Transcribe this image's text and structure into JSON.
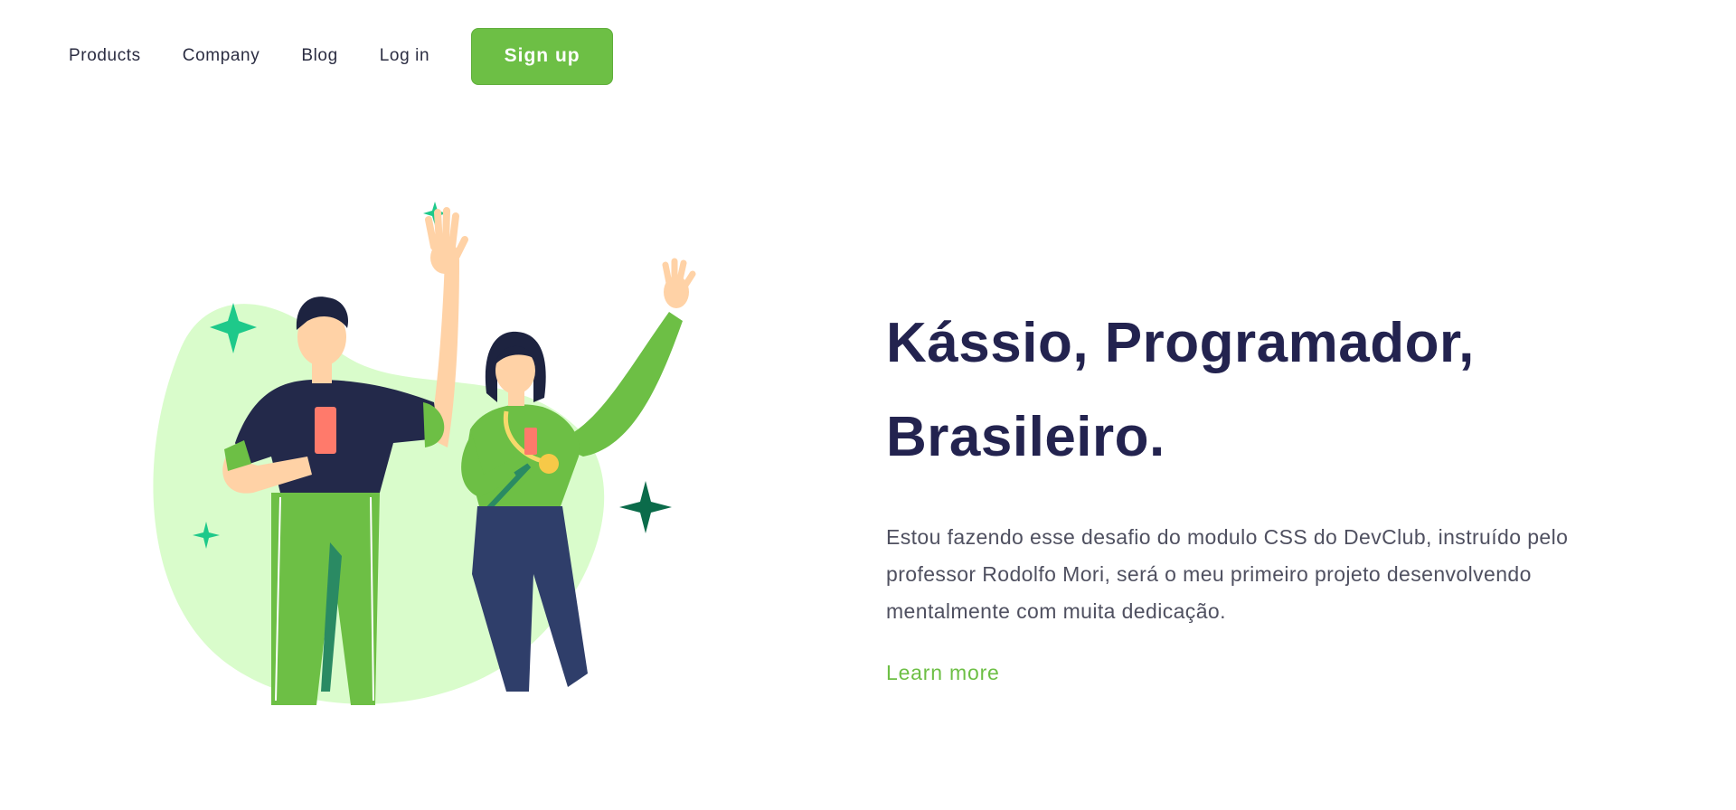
{
  "nav": {
    "links": [
      {
        "label": "Products"
      },
      {
        "label": "Company"
      },
      {
        "label": "Blog"
      },
      {
        "label": "Log in"
      }
    ],
    "signup_label": "Sign up"
  },
  "hero": {
    "title_line1": "Kássio, Programador,",
    "title_line2": "Brasileiro.",
    "description": "Estou fazendo esse desafio do modulo CSS do DevClub, instruído pelo professor Rodolfo Mori, será o meu primeiro projeto desenvolvendo mentalmente com muita dedicação.",
    "learn_more": "Learn more"
  },
  "colors": {
    "accent": "#6dbf45",
    "title": "#23234f",
    "body_text": "#4f5060",
    "blob": "#d9fccb",
    "sparkle": "#1ec98a",
    "sparkle_dark": "#0b6b4a"
  },
  "illustration": {
    "description_icon": "two-people-celebrating-illustration"
  }
}
